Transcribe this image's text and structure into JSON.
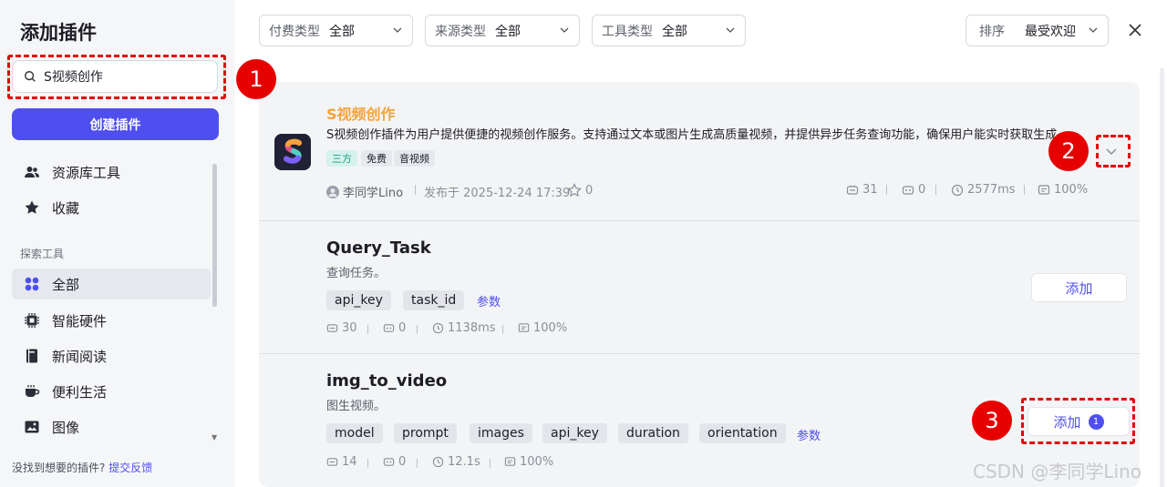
{
  "sidebar": {
    "title": "添加插件",
    "search_value": "S视频创作",
    "create_label": "创建插件",
    "items_top": [
      {
        "label": "资源库工具",
        "icon": "users-icon"
      },
      {
        "label": "收藏",
        "icon": "star-icon"
      }
    ],
    "section_label": "探索工具",
    "items": [
      {
        "label": "全部",
        "icon": "grid-icon"
      },
      {
        "label": "智能硬件",
        "icon": "chip-icon"
      },
      {
        "label": "新闻阅读",
        "icon": "book-icon"
      },
      {
        "label": "便利生活",
        "icon": "coffee-icon"
      },
      {
        "label": "图像",
        "icon": "image-icon"
      }
    ],
    "footer_text": "没找到想要的插件?",
    "footer_link": "提交反馈"
  },
  "filters": [
    {
      "label": "付费类型",
      "value": "全部"
    },
    {
      "label": "来源类型",
      "value": "全部"
    },
    {
      "label": "工具类型",
      "value": "全部"
    }
  ],
  "sort": {
    "label": "排序",
    "value": "最受欢迎"
  },
  "plugin": {
    "name": "S视频创作",
    "description": "S视频创作插件为用户提供便捷的视频创作服务。支持通过文本或图片生成高质量视频，并提供异步任务查询功能，确保用户能实时获取生成…",
    "tags": [
      "三方",
      "免费",
      "音视频"
    ],
    "author": "李同学Lino",
    "published": "发布于 2025-12-24 17:39",
    "stars": "0",
    "stats": {
      "calls": "31",
      "bots": "0",
      "latency": "2577ms",
      "success": "100%"
    }
  },
  "tools": [
    {
      "name": "Query_Task",
      "description": "查询任务。",
      "params": [
        "api_key",
        "task_id"
      ],
      "params_link": "参数",
      "stats": {
        "calls": "30",
        "bots": "0",
        "latency": "1138ms",
        "success": "100%"
      },
      "add_label": "添加"
    },
    {
      "name": "img_to_video",
      "description": "图生视频。",
      "params": [
        "model",
        "prompt",
        "images",
        "api_key",
        "duration",
        "orientation"
      ],
      "params_link": "参数",
      "stats": {
        "calls": "14",
        "bots": "0",
        "latency": "12.1s",
        "success": "100%"
      },
      "add_label": "添加",
      "add_badge": "1"
    }
  ],
  "annotations": [
    "1",
    "2",
    "3"
  ],
  "watermark": "CSDN @李同学Lino",
  "colors": {
    "accent": "#4f4ff0",
    "plugin_name": "#f5a33a",
    "annotation": "#e60000"
  }
}
